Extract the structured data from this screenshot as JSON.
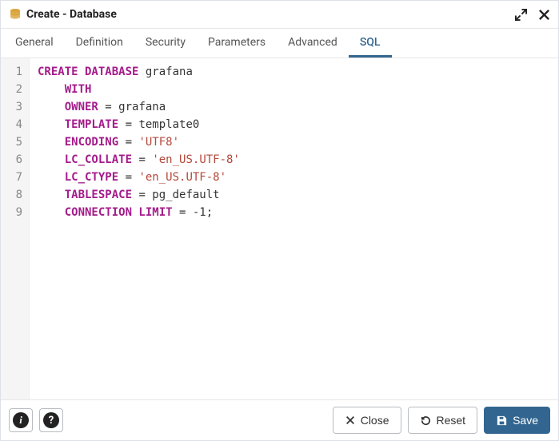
{
  "title": "Create - Database",
  "tabs": [
    {
      "label": "General",
      "active": false
    },
    {
      "label": "Definition",
      "active": false
    },
    {
      "label": "Security",
      "active": false
    },
    {
      "label": "Parameters",
      "active": false
    },
    {
      "label": "Advanced",
      "active": false
    },
    {
      "label": "SQL",
      "active": true
    }
  ],
  "sql": {
    "lines": [
      [
        {
          "t": "kw",
          "s": "CREATE DATABASE"
        },
        {
          "t": "sp",
          "s": " "
        },
        {
          "t": "id",
          "s": "grafana"
        }
      ],
      [
        {
          "t": "pad",
          "s": "    "
        },
        {
          "t": "kw",
          "s": "WITH"
        }
      ],
      [
        {
          "t": "pad",
          "s": "    "
        },
        {
          "t": "kw",
          "s": "OWNER"
        },
        {
          "t": "id",
          "s": " = grafana"
        }
      ],
      [
        {
          "t": "pad",
          "s": "    "
        },
        {
          "t": "kw",
          "s": "TEMPLATE"
        },
        {
          "t": "id",
          "s": " = template0"
        }
      ],
      [
        {
          "t": "pad",
          "s": "    "
        },
        {
          "t": "kw",
          "s": "ENCODING"
        },
        {
          "t": "id",
          "s": " = "
        },
        {
          "t": "str",
          "s": "'UTF8'"
        }
      ],
      [
        {
          "t": "pad",
          "s": "    "
        },
        {
          "t": "kw",
          "s": "LC_COLLATE"
        },
        {
          "t": "id",
          "s": " = "
        },
        {
          "t": "str",
          "s": "'en_US.UTF-8'"
        }
      ],
      [
        {
          "t": "pad",
          "s": "    "
        },
        {
          "t": "kw",
          "s": "LC_CTYPE"
        },
        {
          "t": "id",
          "s": " = "
        },
        {
          "t": "str",
          "s": "'en_US.UTF-8'"
        }
      ],
      [
        {
          "t": "pad",
          "s": "    "
        },
        {
          "t": "kw",
          "s": "TABLESPACE"
        },
        {
          "t": "id",
          "s": " = pg_default"
        }
      ],
      [
        {
          "t": "pad",
          "s": "    "
        },
        {
          "t": "kw",
          "s": "CONNECTION LIMIT"
        },
        {
          "t": "id",
          "s": " = -1;"
        }
      ]
    ]
  },
  "footer": {
    "info_glyph": "i",
    "help_glyph": "?",
    "close_label": "Close",
    "reset_label": "Reset",
    "save_label": "Save"
  }
}
